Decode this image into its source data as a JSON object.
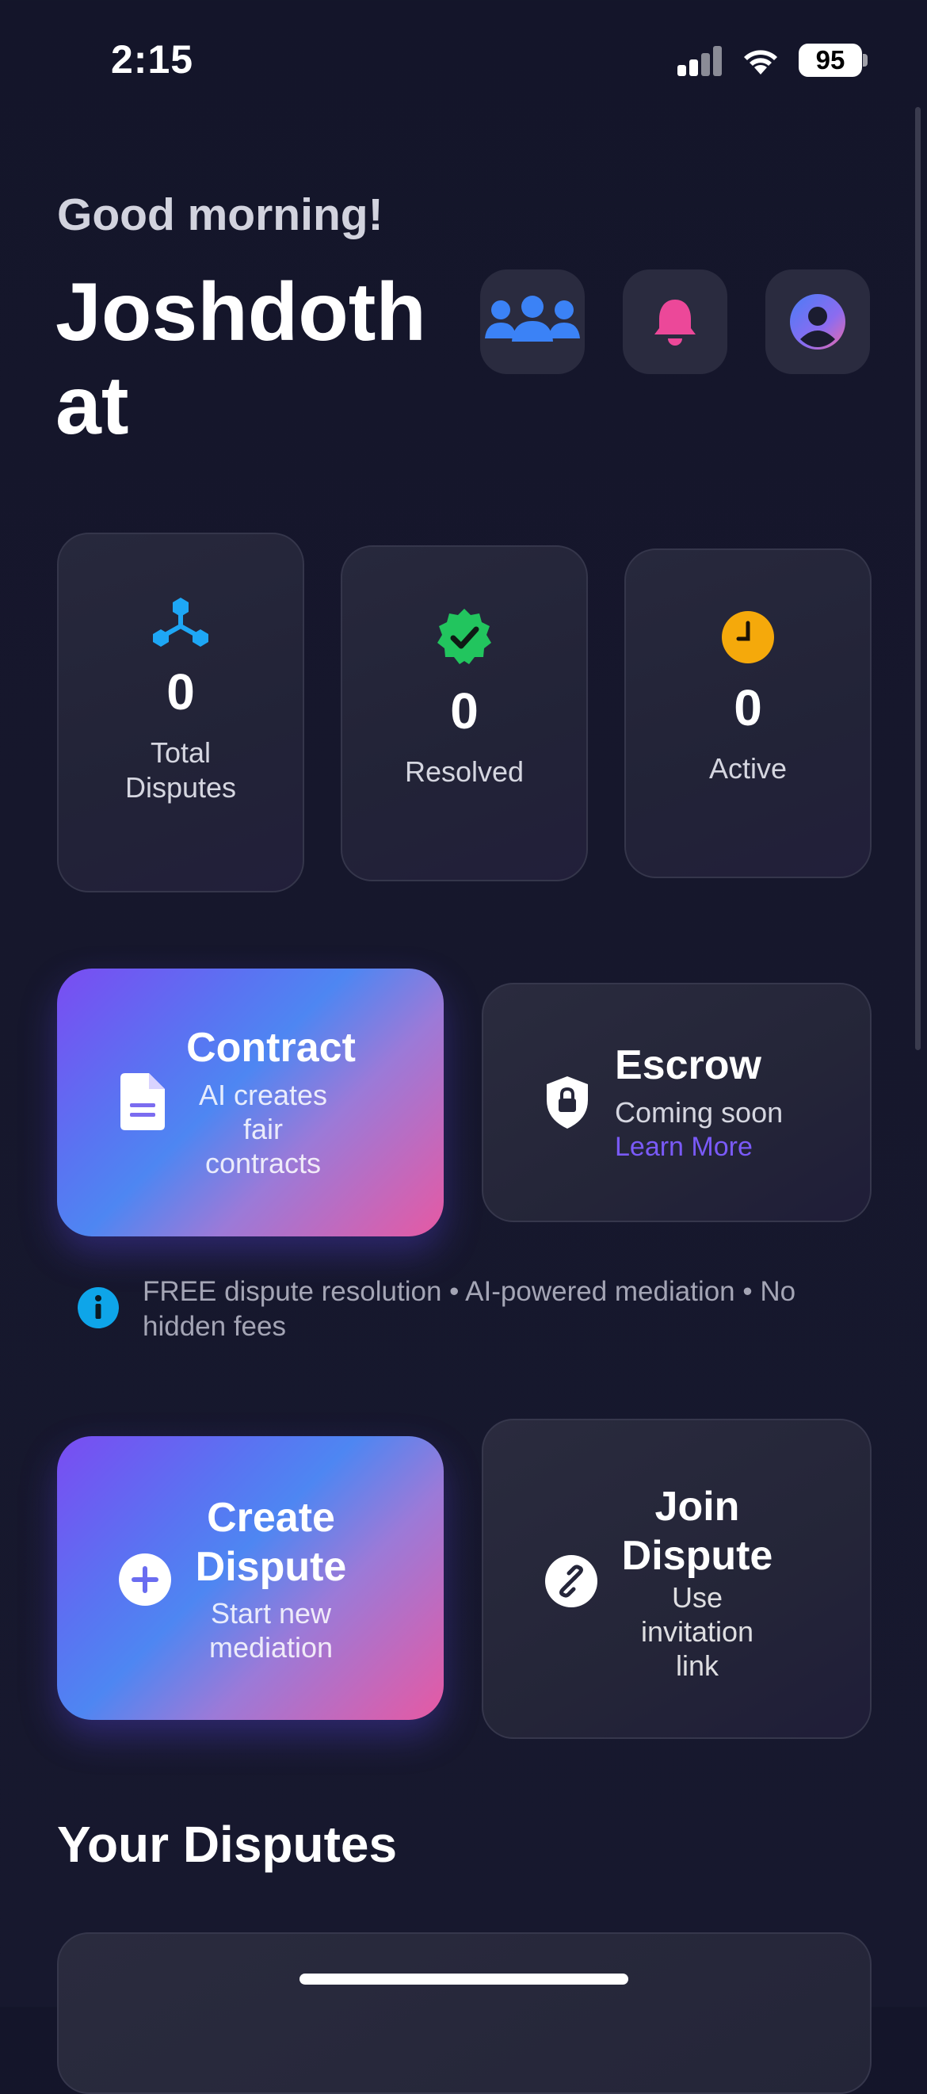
{
  "status_bar": {
    "time": "2:15",
    "battery": "95"
  },
  "header": {
    "greeting": "Good morning!",
    "username": "Joshdothat",
    "buttons": [
      "people-icon",
      "bell-icon",
      "profile-icon"
    ]
  },
  "stats": [
    {
      "value": "0",
      "label": "Total Disputes",
      "icon": "network-icon",
      "color": "#1ea7f5"
    },
    {
      "value": "0",
      "label": "Resolved",
      "icon": "verified-badge-icon",
      "color": "#22c55e"
    },
    {
      "value": "0",
      "label": "Active",
      "icon": "clock-icon",
      "color": "#f5a90b"
    }
  ],
  "contract": {
    "title": "Contract",
    "subtitle": "AI creates fair contracts"
  },
  "escrow": {
    "title": "Escrow",
    "subtitle": "Coming soon",
    "link": "Learn More"
  },
  "info_banner": {
    "text": "FREE dispute resolution • AI-powered mediation • No hidden fees"
  },
  "create_dispute": {
    "title": "Create Dispute",
    "subtitle": "Start new mediation"
  },
  "join_dispute": {
    "title": "Join Dispute",
    "subtitle": "Use invitation link"
  },
  "section": {
    "title": "Your Disputes"
  },
  "colors": {
    "accent": "#7a5af8",
    "pink": "#ec4899",
    "bg": "#15162b"
  }
}
